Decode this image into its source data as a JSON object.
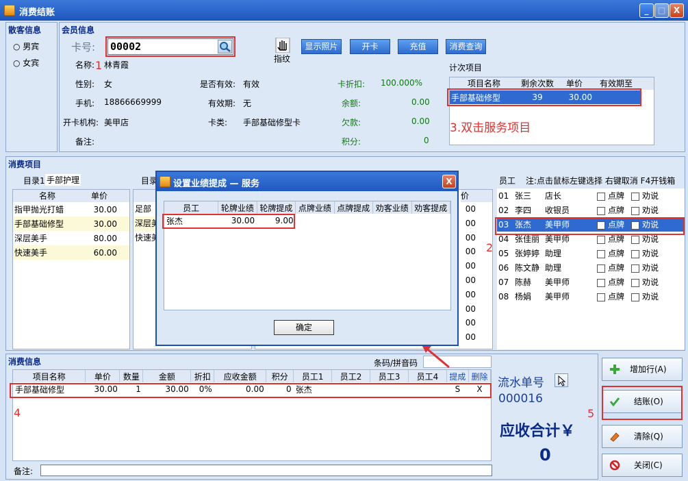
{
  "window": {
    "title": "消费结账",
    "min": "_",
    "max": "□",
    "close": "X"
  },
  "guest": {
    "title": "散客信息",
    "male": "男宾",
    "female": "女宾"
  },
  "member": {
    "title": "会员信息",
    "card_label": "卡号:",
    "card_value": "00002",
    "fingerprint": "指纹",
    "buttons": {
      "photo": "显示照片",
      "open": "开卡",
      "recharge": "充值",
      "query": "消费查询"
    },
    "name_label": "名称:",
    "name": "林青霞",
    "gender_label": "性别:",
    "gender": "女",
    "valid_label": "是否有效:",
    "valid": "有效",
    "discount_label": "卡折扣:",
    "discount": "100.000%",
    "phone_label": "手机:",
    "phone": "18866669999",
    "expire_label": "有效期:",
    "expire": "无",
    "balance_label": "余额:",
    "balance": "0.00",
    "org_label": "开卡机构:",
    "org": "美甲店",
    "type_label": "卡类:",
    "type": "手部基础修型卡",
    "debt_label": "欠款:",
    "debt": "0.00",
    "note_label": "备注:",
    "points_label": "积分:",
    "points": "0"
  },
  "count_items": {
    "title": "计次项目",
    "headers": [
      "项目名称",
      "剩余次数",
      "单价",
      "有效期至"
    ],
    "rows": [
      {
        "name": "手部基础修型",
        "remain": "39",
        "price": "30.00",
        "expiry": ""
      }
    ]
  },
  "annotations": {
    "a1": "1",
    "a2": "2",
    "a3": "3.双击服务项目",
    "a4": "4",
    "a5": "5"
  },
  "consume": {
    "title": "消费项目",
    "cat1_label": "目录1",
    "cat1": "手部护理",
    "cat2_label": "目录",
    "headers": [
      "名称",
      "单价"
    ],
    "items": [
      {
        "name": "指甲抛光打蜡",
        "price": "30.00"
      },
      {
        "name": "手部基础修型",
        "price": "30.00"
      },
      {
        "name": "深层美手",
        "price": "80.00"
      },
      {
        "name": "快速美手",
        "price": "60.00"
      }
    ],
    "col2_items": [
      "足部",
      "深层美",
      "快速美"
    ],
    "col3_header": "价",
    "col3_values": [
      "00",
      "00",
      "00",
      "00",
      "00",
      "00",
      "00",
      "00",
      "00",
      "00"
    ]
  },
  "staff": {
    "title": "员工",
    "hint": "注:点击鼠标左键选择 右键取消 F4开钱箱",
    "brand": "点牌",
    "persuade": "劝说",
    "rows": [
      {
        "no": "01",
        "name": "张三",
        "role": "店长"
      },
      {
        "no": "02",
        "name": "李四",
        "role": "收银员"
      },
      {
        "no": "03",
        "name": "张杰",
        "role": "美甲师"
      },
      {
        "no": "04",
        "name": "张佳丽",
        "role": "美甲师"
      },
      {
        "no": "05",
        "name": "张婷婷",
        "role": "助理"
      },
      {
        "no": "06",
        "name": "陈文静",
        "role": "助理"
      },
      {
        "no": "07",
        "name": "陈赫",
        "role": "美甲师"
      },
      {
        "no": "08",
        "name": "杨娟",
        "role": "美甲师"
      }
    ]
  },
  "dialog": {
    "title": "设置业绩提成 — 服务",
    "close": "X",
    "headers": [
      "员工",
      "轮牌业绩",
      "轮牌提成",
      "点牌业绩",
      "点牌提成",
      "劝客业绩",
      "劝客提成"
    ],
    "rows": [
      {
        "staff": "张杰",
        "perf": "30.00",
        "comm": "9.00"
      }
    ],
    "ok": "确定"
  },
  "bill": {
    "title": "消费信息",
    "barcode_label": "条码/拼音码",
    "headers": [
      "项目名称",
      "单价",
      "数量",
      "金额",
      "折扣",
      "应收金额",
      "积分",
      "员工1",
      "员工2",
      "员工3",
      "员工4",
      "提成",
      "删除"
    ],
    "rows": [
      {
        "name": "手部基础修型",
        "price": "30.00",
        "qty": "1",
        "amount": "30.00",
        "discount": "0%",
        "receivable": "0.00",
        "points": "0",
        "emp1": "张杰",
        "emp2": "",
        "emp3": "",
        "emp4": "",
        "comm": "S",
        "del": "X"
      }
    ],
    "note_label": "备注:"
  },
  "summary": {
    "serial_label": "流水单号",
    "serial": "000016",
    "total_label": "应收合计￥",
    "total": "0"
  },
  "actions": {
    "add": "增加行(A)",
    "checkout": "结账(O)",
    "clear": "清除(Q)",
    "close": "关闭(C)"
  }
}
